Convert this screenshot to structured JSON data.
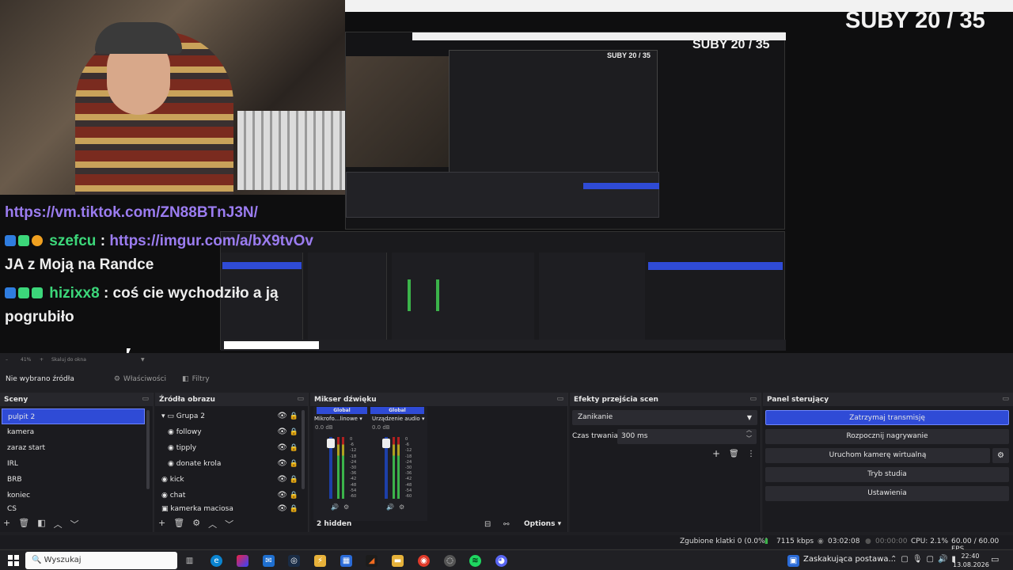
{
  "overlay": {
    "subs": "SUBY 20 / 35"
  },
  "chat": {
    "line1_link": "https://vm.tiktok.com/ZN88BTnJ3N/",
    "line2_nick": "szefcu",
    "line2_link": "https://imgur.com/a/bX9tvOv",
    "line3": "JA z Moją na Randce",
    "line4_nick": "hizixx8",
    "line4_msg": ": coś cie wychodziło a ją",
    "line5": "pogrubiło"
  },
  "zoom": {
    "percent": "41%",
    "label": "Skaluj do okna"
  },
  "source_bar": {
    "none_selected": "Nie wybrano źródła",
    "properties": "Właściwości",
    "filters": "Filtry"
  },
  "scenes": {
    "title": "Sceny",
    "items": [
      "pulpit 2",
      "kamera",
      "zaraz start",
      "IRL",
      "BRB",
      "koniec",
      "CS"
    ]
  },
  "sources": {
    "title": "Źródła obrazu",
    "items": [
      {
        "label": "Grupa 2"
      },
      {
        "label": "followy"
      },
      {
        "label": "tipply"
      },
      {
        "label": "donate krola"
      },
      {
        "label": "kick"
      },
      {
        "label": "chat"
      },
      {
        "label": "kamerka maciosa"
      }
    ]
  },
  "mixer": {
    "title": "Mikser dźwięku",
    "ch1_badge": "Global",
    "ch1_name": "Mikrofo...linowe",
    "ch1_db": "0.0 dB",
    "ch2_badge": "Global",
    "ch2_name": "Urządzenie audio",
    "ch2_db": "0.0 dB",
    "scale": [
      "0",
      "-6",
      "-12",
      "-18",
      "-24",
      "-30",
      "-36",
      "-42",
      "-48",
      "-54",
      "-60"
    ],
    "hidden": "2 hidden",
    "options": "Options"
  },
  "transitions": {
    "title": "Efekty przejścia scen",
    "selected": "Zanikanie",
    "duration_label": "Czas trwania",
    "duration_value": "300 ms"
  },
  "controls": {
    "title": "Panel sterujący",
    "stop_stream": "Zatrzymaj transmisję",
    "start_recording": "Rozpocznij nagrywanie",
    "virtual_cam": "Uruchom kamerę wirtualną",
    "studio_mode": "Tryb studia",
    "settings": "Ustawienia"
  },
  "status": {
    "dropped": "Zgubione klatki 0 (0.0%)",
    "kbps": "7115 kbps",
    "stream_time": "03:02:08",
    "rec_time": "00:00:00",
    "cpu": "CPU: 2.1%",
    "fps": "60.00 / 60.00 FPS"
  },
  "taskbar": {
    "search": "Wyszukaj",
    "notification": "Zaskakująca postawa...",
    "time": "22:40",
    "date": "13.08.2026"
  },
  "colors": {
    "accent": "#2f4bd6",
    "chat_nick": "#3cd77a",
    "chat_link": "#9b7cf0",
    "meter_green": "#3bb34a"
  }
}
